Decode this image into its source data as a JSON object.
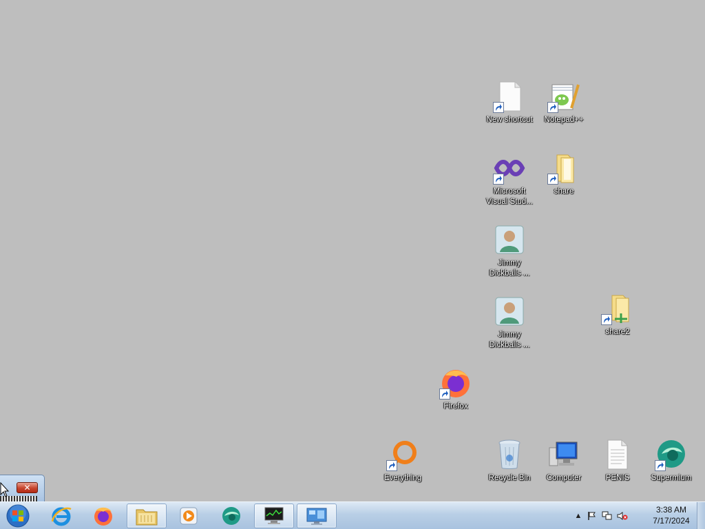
{
  "desktop": {
    "icons": {
      "new_shortcut": "New shortcut",
      "notepadpp": "Notepad++",
      "msvs": "Microsoft Visual Stud...",
      "share": "share",
      "jimmy1": "Jimmy Dickballs ...",
      "jimmy2": "Jimmy Dickballs ...",
      "share2": "share2",
      "firefox": "Firefox",
      "everything": "Everything",
      "recycle_bin": "Recycle Bin",
      "computer": "Computer",
      "penis": "PENIS",
      "supermium": "Supermium"
    }
  },
  "mini_window": {
    "close_label": "✕"
  },
  "taskbar": {
    "clock_time": "3:38 AM",
    "clock_date": "7/17/2024",
    "tray_arrow": "▲"
  },
  "colors": {
    "desktop_bg": "#bebebe",
    "taskbar_top": "#dde9f5",
    "taskbar_bottom": "#a8c2df"
  }
}
